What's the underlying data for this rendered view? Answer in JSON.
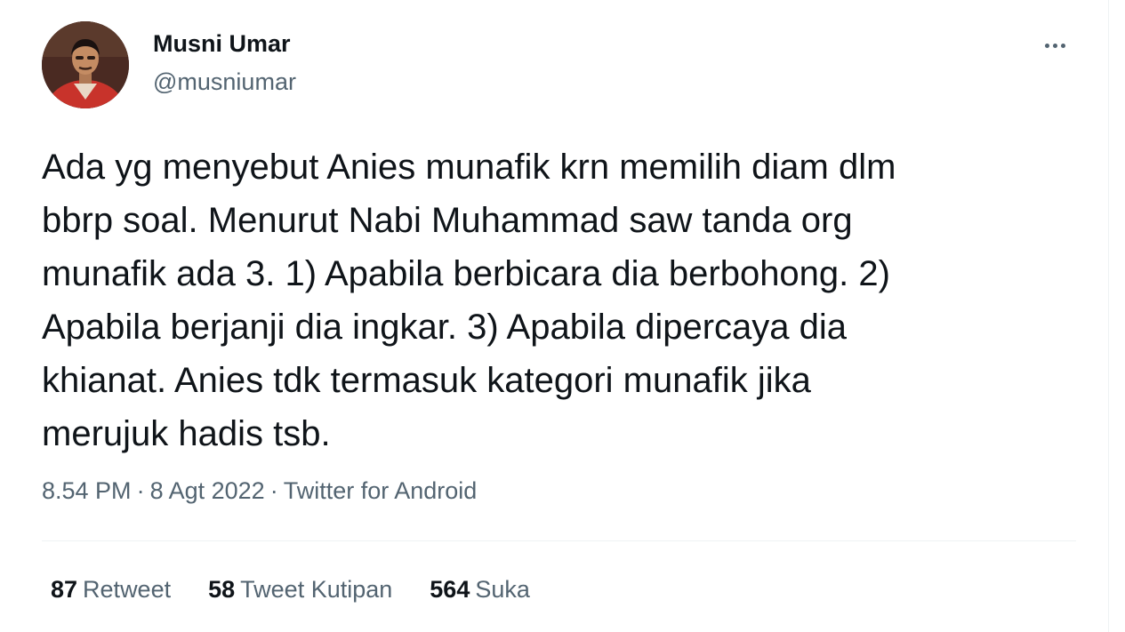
{
  "user": {
    "name": "Musni Umar",
    "handle": "@musniumar"
  },
  "more_icon": "more-horizontal-icon",
  "tweet": {
    "text": "Ada yg menyebut Anies munafik krn memilih diam dlm\nbbrp soal. Menurut Nabi Muhammad saw tanda org\nmunafik ada 3. 1) Apabila berbicara dia berbohong. 2)\nApabila berjanji dia ingkar. 3) Apabila dipercaya dia\nkhianat. Anies tdk termasuk kategori munafik jika\nmerujuk hadis tsb."
  },
  "meta": {
    "time": "8.54 PM",
    "date": "8 Agt 2022",
    "source": "Twitter for Android",
    "separator": "·"
  },
  "stats": {
    "retweets": {
      "count": "87",
      "label": "Retweet"
    },
    "quotes": {
      "count": "58",
      "label": "Tweet Kutipan"
    },
    "likes": {
      "count": "564",
      "label": "Suka"
    }
  },
  "colors": {
    "text_primary": "#0f1419",
    "text_secondary": "#536471",
    "divider": "#eff3f4"
  }
}
